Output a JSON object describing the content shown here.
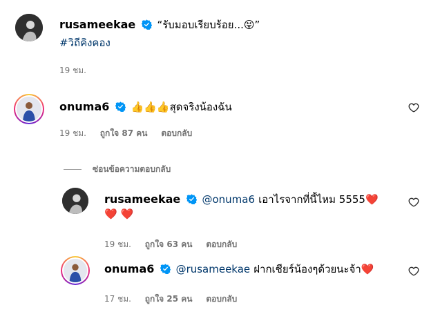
{
  "caption": {
    "username": "rusameekae",
    "text": "“รับมอบเรียบร้อย...😝”",
    "hashtag": "#วิถีคิงคอง",
    "time": "19 ชม."
  },
  "hide_replies_label": "ซ่อนข้อความตอบกลับ",
  "comments": [
    {
      "username": "onuma6",
      "text": "👍👍👍สุดจริงน้องฉัน",
      "time": "19 ชม.",
      "likes": "ถูกใจ 87 คน",
      "reply": "ตอบกลับ"
    },
    {
      "username": "rusameekae",
      "mention": "@onuma6",
      "text_line1": "เอาไรจากที่นี้ไหม 5555❤️",
      "text_line2": "❤️ ❤️",
      "time": "19 ชม.",
      "likes": "ถูกใจ 63 คน",
      "reply": "ตอบกลับ"
    },
    {
      "username": "onuma6",
      "mention": "@rusameekae",
      "text": "ฝากเชียร์น้องๆด้วยนะจ้า❤️",
      "time": "17 ชม.",
      "likes": "ถูกใจ 25 คน",
      "reply": "ตอบกลับ"
    }
  ],
  "colors": {
    "link": "#00376b",
    "meta": "#737373",
    "verified": "#0095f6"
  },
  "icons": [
    "verified-badge-icon",
    "heart-outline-icon"
  ]
}
